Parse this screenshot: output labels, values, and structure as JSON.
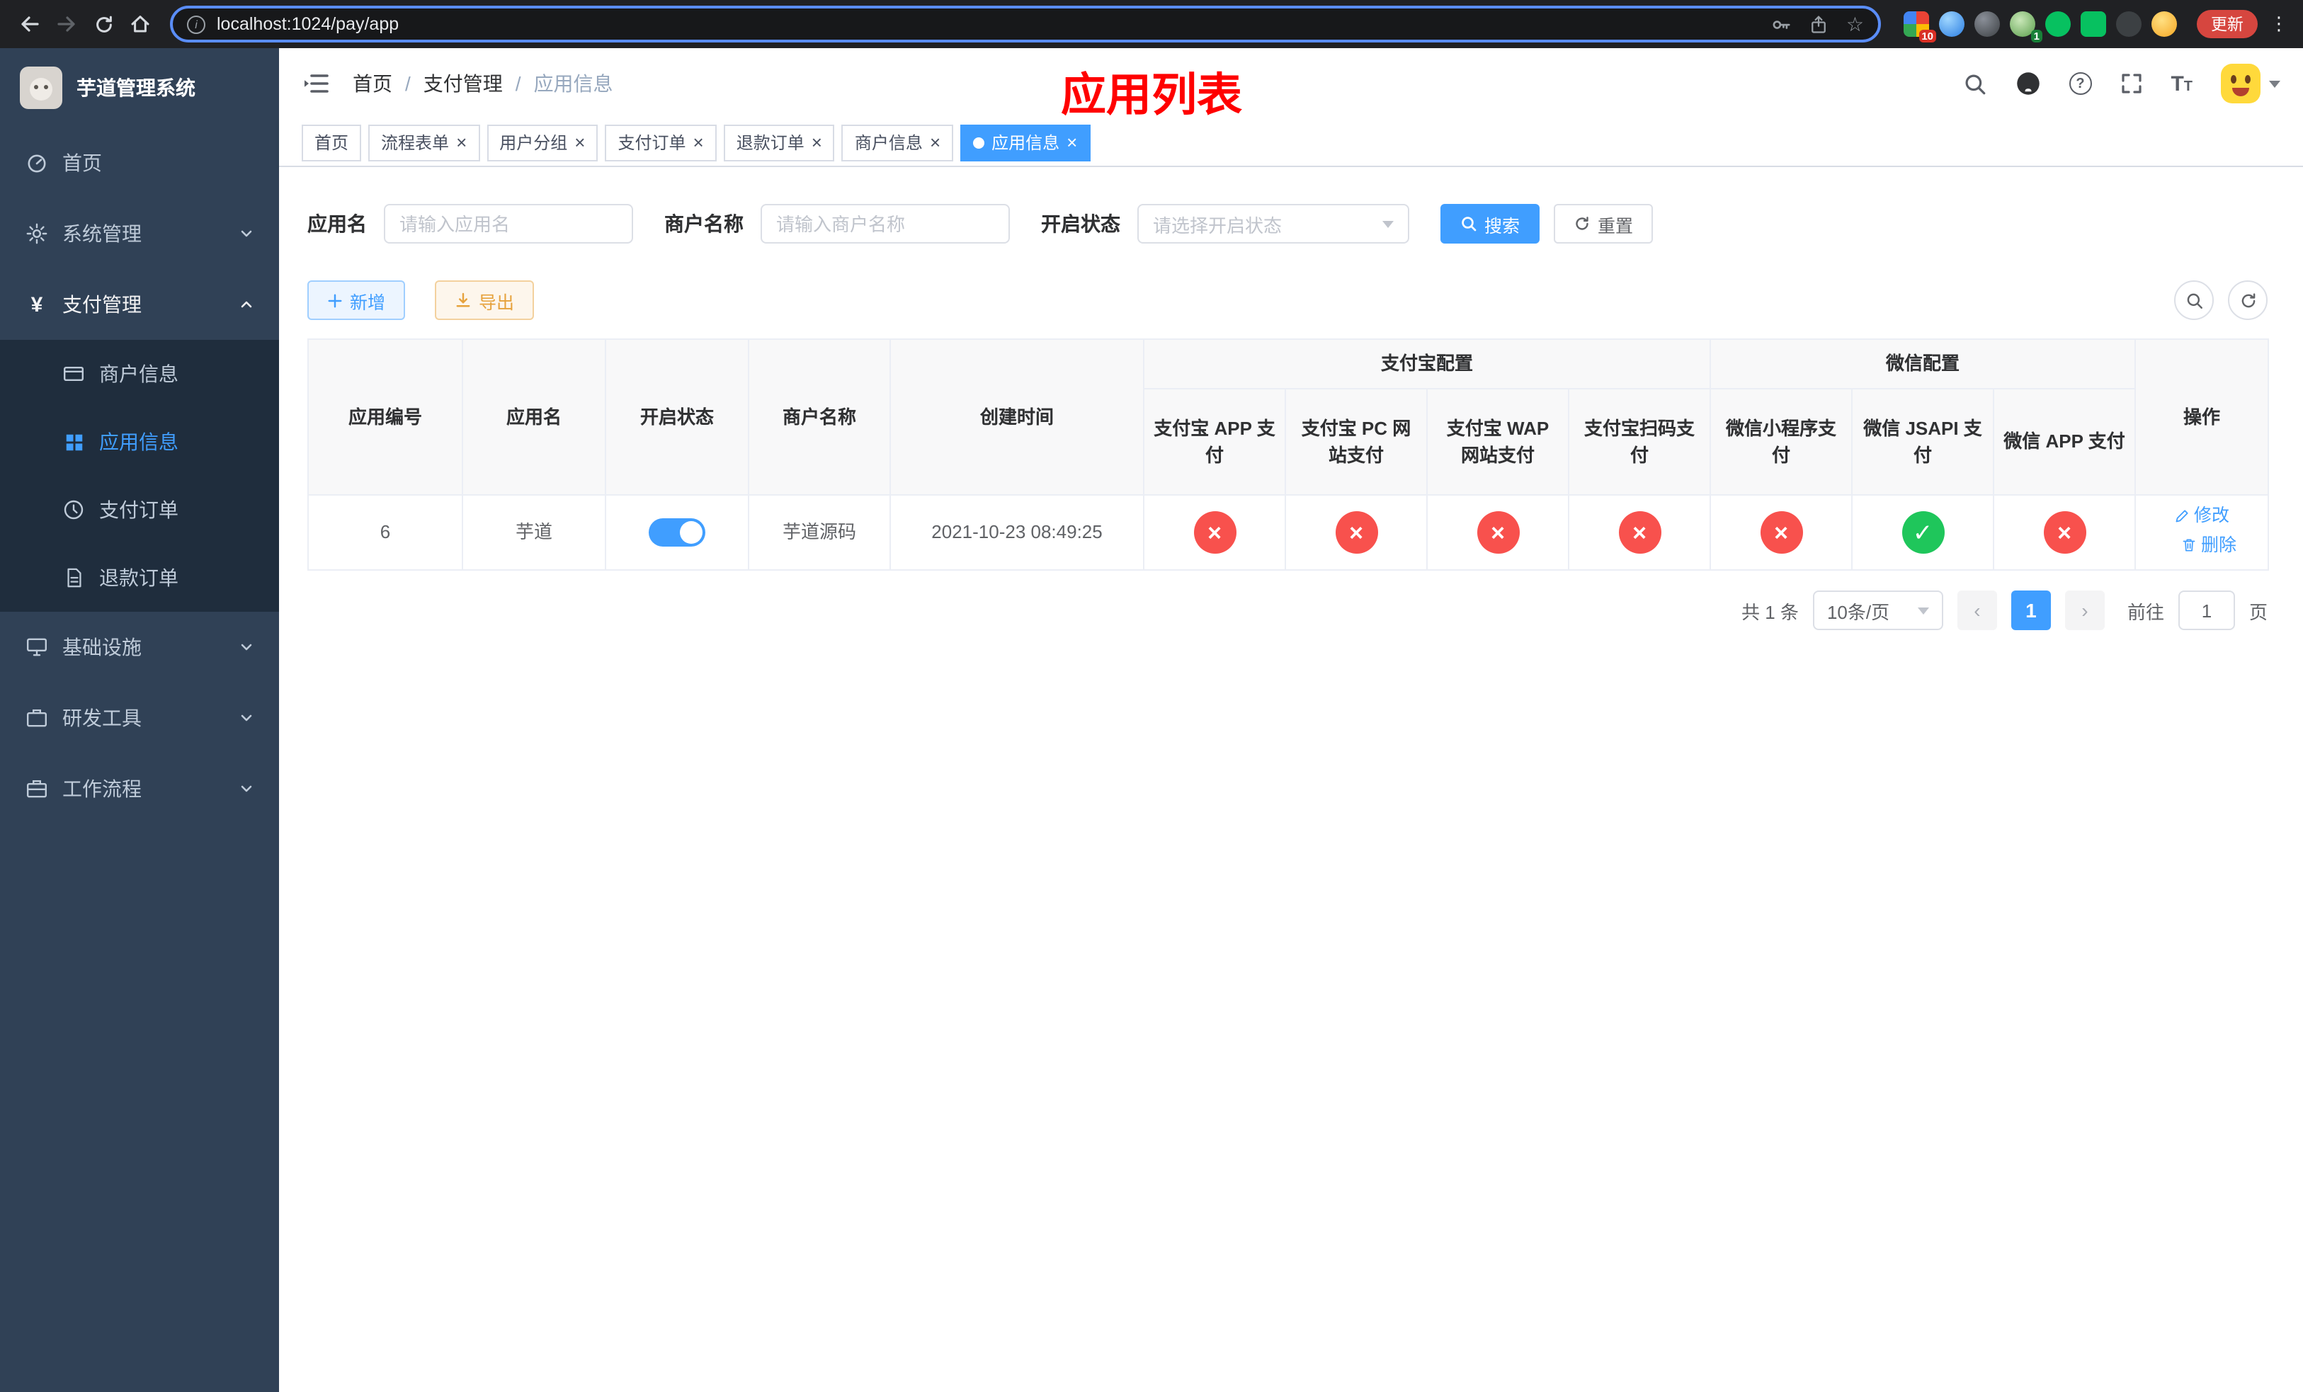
{
  "colors": {
    "accent": "#409eff",
    "status_on": "#1fc65b",
    "status_off": "#f8514d",
    "overlay_red": "#ff0000"
  },
  "browser": {
    "url": "localhost:1024/pay/app",
    "update_label": "更新",
    "ext_badge_a": "10",
    "ext_badge_b": "1"
  },
  "sidebar": {
    "title": "芋道管理系统",
    "menu": [
      {
        "label": "首页"
      },
      {
        "label": "系统管理"
      },
      {
        "label": "支付管理"
      },
      {
        "label": "基础设施"
      },
      {
        "label": "研发工具"
      },
      {
        "label": "工作流程"
      }
    ],
    "submenu": [
      {
        "label": "商户信息"
      },
      {
        "label": "应用信息"
      },
      {
        "label": "支付订单"
      },
      {
        "label": "退款订单"
      }
    ]
  },
  "header": {
    "breadcrumb": [
      "首页",
      "支付管理",
      "应用信息"
    ],
    "overlay_title": "应用列表"
  },
  "tabs": [
    {
      "label": "首页"
    },
    {
      "label": "流程表单"
    },
    {
      "label": "用户分组"
    },
    {
      "label": "支付订单"
    },
    {
      "label": "退款订单"
    },
    {
      "label": "商户信息"
    },
    {
      "label": "应用信息"
    }
  ],
  "filters": {
    "app_name": {
      "label": "应用名",
      "placeholder": "请输入应用名",
      "value": ""
    },
    "merchant_name": {
      "label": "商户名称",
      "placeholder": "请输入商户名称",
      "value": ""
    },
    "status": {
      "label": "开启状态",
      "placeholder": "请选择开启状态"
    },
    "search_label": "搜索",
    "reset_label": "重置"
  },
  "toolbar": {
    "add_label": "新增",
    "export_label": "导出"
  },
  "table": {
    "headers": {
      "app_id": "应用编号",
      "app_name": "应用名",
      "status": "开启状态",
      "merchant_name": "商户名称",
      "create_time": "创建时间",
      "alipay_group": "支付宝配置",
      "wechat_group": "微信配置",
      "alipay_cols": [
        "支付宝 APP 支付",
        "支付宝 PC 网站支付",
        "支付宝 WAP 网站支付",
        "支付宝扫码支付"
      ],
      "wechat_cols": [
        "微信小程序支付",
        "微信 JSAPI 支付",
        "微信 APP 支付"
      ],
      "actions": "操作"
    },
    "row": {
      "app_id": "6",
      "app_name": "芋道",
      "enabled": true,
      "merchant_name": "芋道源码",
      "create_time": "2021-10-23 08:49:25",
      "statuses": [
        false,
        false,
        false,
        false,
        false,
        true,
        false
      ],
      "edit_label": "修改",
      "delete_label": "删除"
    }
  },
  "pagination": {
    "total_text": "共 1 条",
    "page_size": "10条/页",
    "prev_label": "‹",
    "current_page": "1",
    "next_label": "›",
    "goto_prefix": "前往",
    "goto_value": "1",
    "goto_suffix": "页"
  }
}
